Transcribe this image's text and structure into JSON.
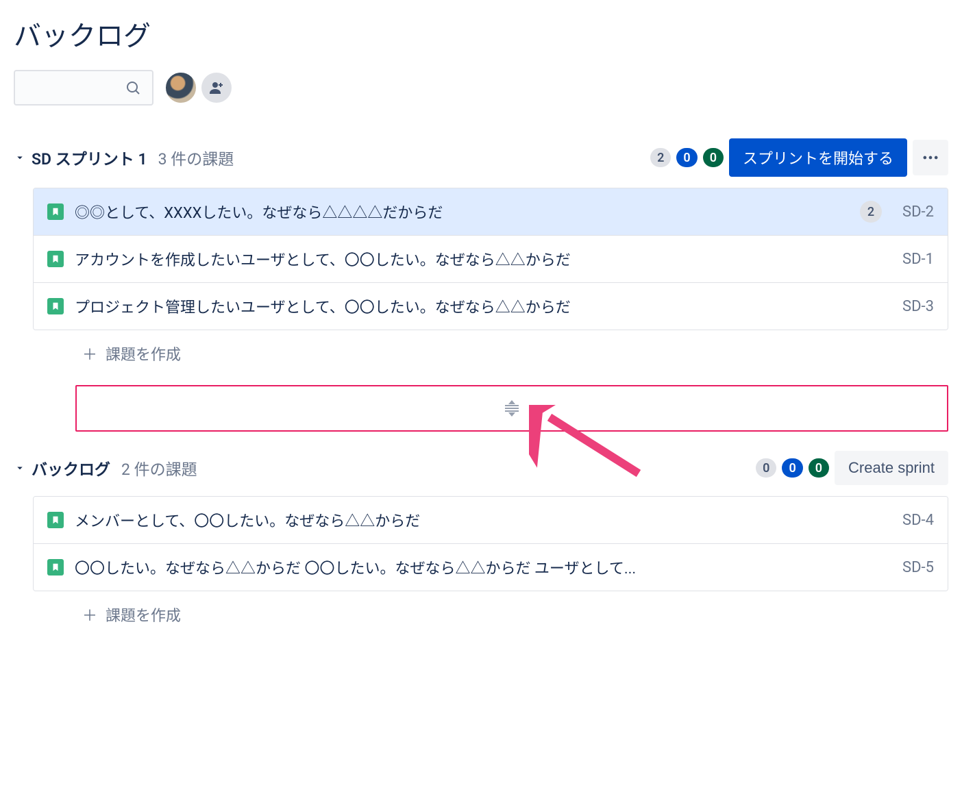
{
  "page_title": "バックログ",
  "search": {
    "placeholder": ""
  },
  "add_user_tooltip": "メンバーを追加",
  "sprint": {
    "name": "SD スプリント 1",
    "count_label": "3 件の課題",
    "badges": {
      "gray": "2",
      "blue": "0",
      "green": "0"
    },
    "start_button": "スプリントを開始する",
    "issues": [
      {
        "title": "◎◎として、XXXXしたい。なぜなら△△△△だからだ",
        "key": "SD-2",
        "estimate": "2",
        "selected": true
      },
      {
        "title": "アカウントを作成したいユーザとして、〇〇したい。なぜなら△△からだ",
        "key": "SD-1",
        "estimate": null,
        "selected": false
      },
      {
        "title": "プロジェクト管理したいユーザとして、〇〇したい。なぜなら△△からだ",
        "key": "SD-3",
        "estimate": null,
        "selected": false
      }
    ]
  },
  "backlog": {
    "name": "バックログ",
    "count_label": "2 件の課題",
    "badges": {
      "gray": "0",
      "blue": "0",
      "green": "0"
    },
    "create_sprint_button": "Create sprint",
    "issues": [
      {
        "title": "メンバーとして、〇〇したい。なぜなら△△からだ",
        "key": "SD-4",
        "estimate": null
      },
      {
        "title": "〇〇したい。なぜなら△△からだ 〇〇したい。なぜなら△△からだ ユーザとして...",
        "key": "SD-5",
        "estimate": null
      }
    ]
  },
  "create_issue_label": "課題を作成",
  "annotation": {
    "arrow_color": "#E91E63",
    "highlight_color": "#E91E63"
  }
}
